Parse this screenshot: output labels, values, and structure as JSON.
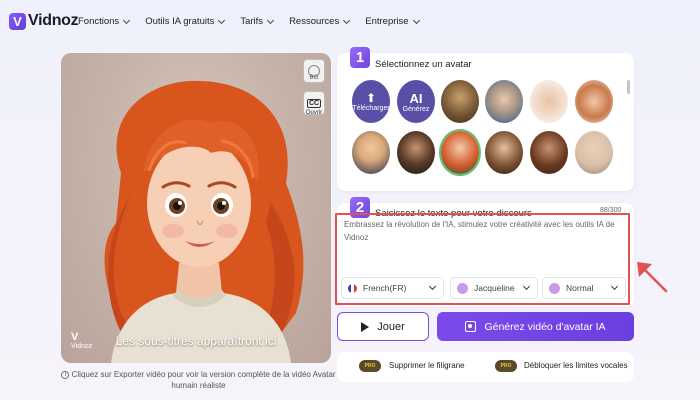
{
  "brand": {
    "name": "Vidnoz"
  },
  "nav": {
    "items": [
      {
        "label": "Fonctions"
      },
      {
        "label": "Outils IA gratuits"
      },
      {
        "label": "Tarifs"
      },
      {
        "label": "Ressources"
      },
      {
        "label": "Entreprise"
      }
    ]
  },
  "preview": {
    "bg_label": "BG",
    "cc_label": "CC",
    "open_label": "Ouvrir",
    "subtitle_placeholder": "Les sous-titres apparaîtront ici",
    "watermark": "Vidnoz",
    "hint": "Cliquez sur Exporter vidéo pour voir la version complète de la vidéo Avatar humain réaliste"
  },
  "step1": {
    "number": "1",
    "title": "Sélectionnez un avatar",
    "upload_label": "Télécharger",
    "ai_label": "Générez",
    "ai_mark": "AI"
  },
  "step2": {
    "number": "2",
    "title": "Saisissez le texte pour votre discours",
    "counter": "88/300",
    "text": "Embrassez la révolution de l'IA, stimulez votre créativité avec les outils IA de Vidnoz",
    "language": "French(FR)",
    "voice": "Jacqueline",
    "tone": "Normal"
  },
  "actions": {
    "play_label": "Jouer",
    "generate_label": "Générez vidéo d'avatar IA"
  },
  "pro": {
    "badge": "PRO",
    "remove_watermark": "Supprimer le filigrane",
    "unlock_voice": "Débloquer les limites vocales"
  },
  "colors": {
    "accent": "#7a4bea",
    "highlight_box": "#e35252"
  }
}
